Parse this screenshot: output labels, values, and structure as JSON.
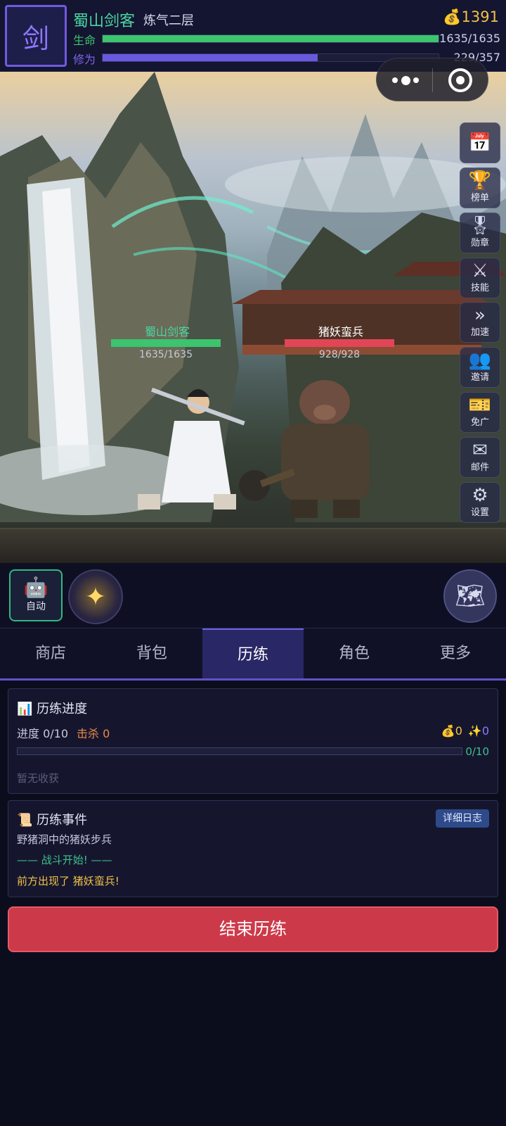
{
  "header": {
    "avatar_char": "剑",
    "player_name": "蜀山剑客",
    "realm": "炼气二层",
    "gold": "1391",
    "hp": {
      "label": "生命",
      "text": "1635/1635",
      "fraction": 1.0,
      "color": "#3cc46e"
    },
    "cultivation": {
      "label": "修为",
      "text": "229/357",
      "fraction": 0.64,
      "color": "#6a58e0"
    }
  },
  "battle": {
    "player": {
      "name": "蜀山剑客",
      "hp_text": "1635/1635",
      "hp_fraction": 1.0
    },
    "enemy": {
      "name": "猪妖蛮兵",
      "hp_text": "928/928",
      "hp_fraction": 1.0
    }
  },
  "side_menu": [
    {
      "name": "calendar",
      "label": "",
      "icon": "📅",
      "icon_name": "calendar-icon"
    },
    {
      "name": "ranking",
      "label": "榜单",
      "icon": "🏆",
      "icon_name": "trophy-icon"
    },
    {
      "name": "medal",
      "label": "勋章",
      "icon": "🎖",
      "icon_name": "medal-icon"
    },
    {
      "name": "skill",
      "label": "技能",
      "icon": "⚔",
      "icon_name": "crossed-swords-icon"
    },
    {
      "name": "speedup",
      "label": "加速",
      "icon": "»",
      "icon_name": "fast-forward-icon"
    },
    {
      "name": "invite",
      "label": "邀请",
      "icon": "👥",
      "icon_name": "invite-icon"
    },
    {
      "name": "free-ads",
      "label": "免广",
      "icon": "🎫",
      "icon_name": "ticket-icon"
    },
    {
      "name": "mail",
      "label": "邮件",
      "icon": "✉",
      "icon_name": "mail-icon"
    },
    {
      "name": "settings",
      "label": "设置",
      "icon": "⚙",
      "icon_name": "gear-icon"
    }
  ],
  "actions": {
    "auto_label": "自动",
    "auto_icon": "🤖",
    "skill_icon": "✦",
    "map_icon": "🗺"
  },
  "tabs": [
    {
      "label": "商店",
      "active": false
    },
    {
      "label": "背包",
      "active": false
    },
    {
      "label": "历练",
      "active": true
    },
    {
      "label": "角色",
      "active": false
    },
    {
      "label": "更多",
      "active": false
    }
  ],
  "progress": {
    "title_icon": "📊",
    "title": "历练进度",
    "progress_text": "进度 0/10",
    "kill_text": "击杀 0",
    "gold_icon": "💰",
    "gold_gain": "0",
    "spirit_icon": "✨",
    "spirit_gain": "0",
    "fraction_text": "0/10",
    "fraction": 0.0,
    "harvest_text": "暂无收获"
  },
  "events": {
    "title_icon": "📜",
    "title": "历练事件",
    "log_button": "详细日志",
    "lines": [
      {
        "text": "野猪洞中的猪妖步兵",
        "color": "#c6c8dc"
      },
      {
        "text": "—— 战斗开始! ——",
        "color": "#3fc08e"
      },
      {
        "text": "前方出现了 猪妖蛮兵!",
        "color": "#f0c04a"
      }
    ]
  },
  "end_button": "结束历练"
}
